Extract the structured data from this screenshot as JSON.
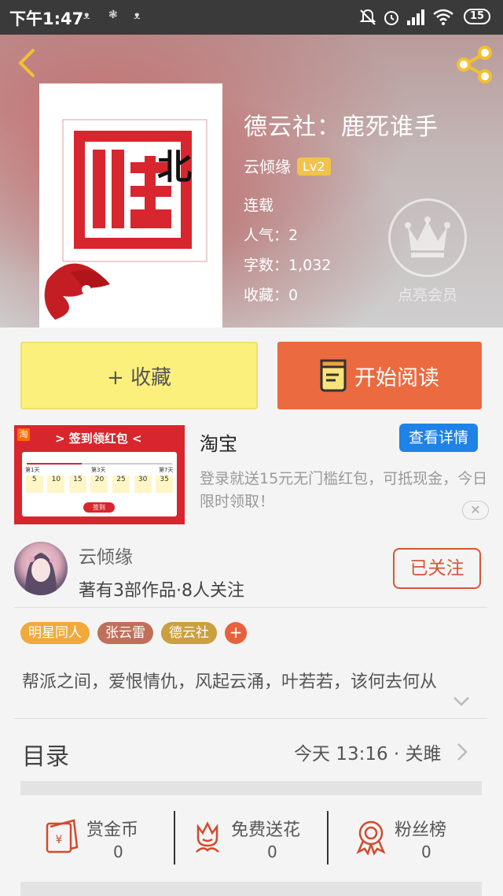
{
  "status_bar": {
    "time": "下午1:47",
    "battery": "15"
  },
  "book": {
    "title": "德云社：鹿死谁手",
    "author": "云倾缘",
    "level": "Lv2",
    "status": "连载",
    "popularity": "人气：2",
    "word_count": "字数：1,032",
    "favorites": "收藏：0",
    "cover_text": "北"
  },
  "vip": {
    "label": "点亮会员"
  },
  "actions": {
    "collect_label": "+ 收藏",
    "read_label": "开始阅读"
  },
  "ad": {
    "source": "淘宝",
    "detail_label": "查看详情",
    "description": "登录就送15元无门槛红包，可抵现金，今日限时领取！",
    "close": "✕",
    "banner_title": "> 签到领红包 <",
    "banner_days": [
      "第1天",
      "第3天",
      "第7天"
    ],
    "banner_amounts": [
      "5",
      "10",
      "15",
      "20",
      "25",
      "30",
      "35"
    ],
    "banner_button": "签到"
  },
  "author_card": {
    "name": "云倾缘",
    "info": "著有3部作品·8人关注",
    "follow_label": "已关注"
  },
  "tags": [
    {
      "label": "明星同人",
      "color": "#f2a93b"
    },
    {
      "label": "张云雷",
      "color": "#c0705a"
    },
    {
      "label": "德云社",
      "color": "#caa040"
    }
  ],
  "tag_add": "+",
  "synopsis": "帮派之间，爱恨情仇，风起云涌，叶若若，该何去何从",
  "catalog": {
    "label": "目录",
    "update": "今天 13:16 · 关雎"
  },
  "stats": [
    {
      "label": "赏金币",
      "value": "0"
    },
    {
      "label": "免费送花",
      "value": "0"
    },
    {
      "label": "粉丝榜",
      "value": "0"
    }
  ],
  "colors": {
    "accent_orange": "#ec6a3f",
    "collect_yellow": "#fbf07c",
    "icon_red": "#d34a2e",
    "link_blue": "#1f82e6"
  }
}
